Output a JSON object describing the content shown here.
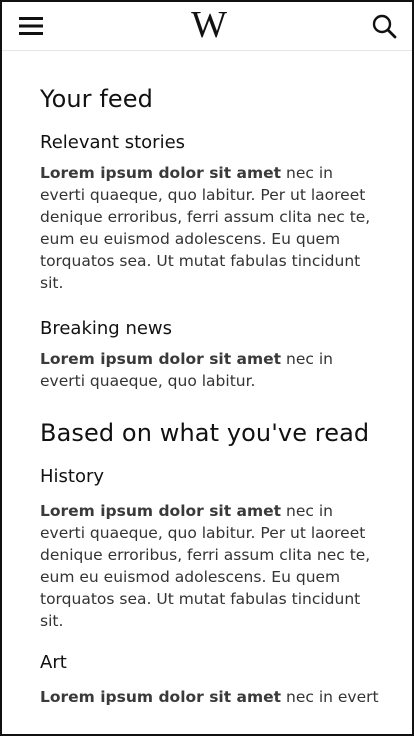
{
  "header": {
    "logo_text": "W",
    "icons": {
      "menu": "menu-icon",
      "search": "search-icon"
    }
  },
  "feed": {
    "title": "Your feed",
    "relevant": {
      "title": "Relevant stories",
      "lead": "Lorem ipsum dolor sit amet",
      "text": " nec in everti quaeque, quo labitur. Per ut laoreet denique erroribus, ferri assum clita nec te, eum eu euismod adolescens. Eu quem torquatos sea. Ut mutat fabulas tincidunt sit."
    },
    "breaking": {
      "title": "Breaking news",
      "lead": "Lorem ipsum dolor sit amet",
      "text": " nec in everti quaeque, quo labitur."
    }
  },
  "based": {
    "title": "Based on what you've read",
    "history": {
      "title": "History",
      "lead": "Lorem ipsum dolor sit amet",
      "text": " nec in everti quaeque, quo labitur. Per ut laoreet denique erroribus, ferri assum clita nec te, eum eu euismod adolescens. Eu quem torquatos sea. Ut mutat fabulas tincidunt sit."
    },
    "art": {
      "title": "Art",
      "lead": "Lorem ipsum dolor sit amet",
      "text": " nec in everti"
    }
  }
}
